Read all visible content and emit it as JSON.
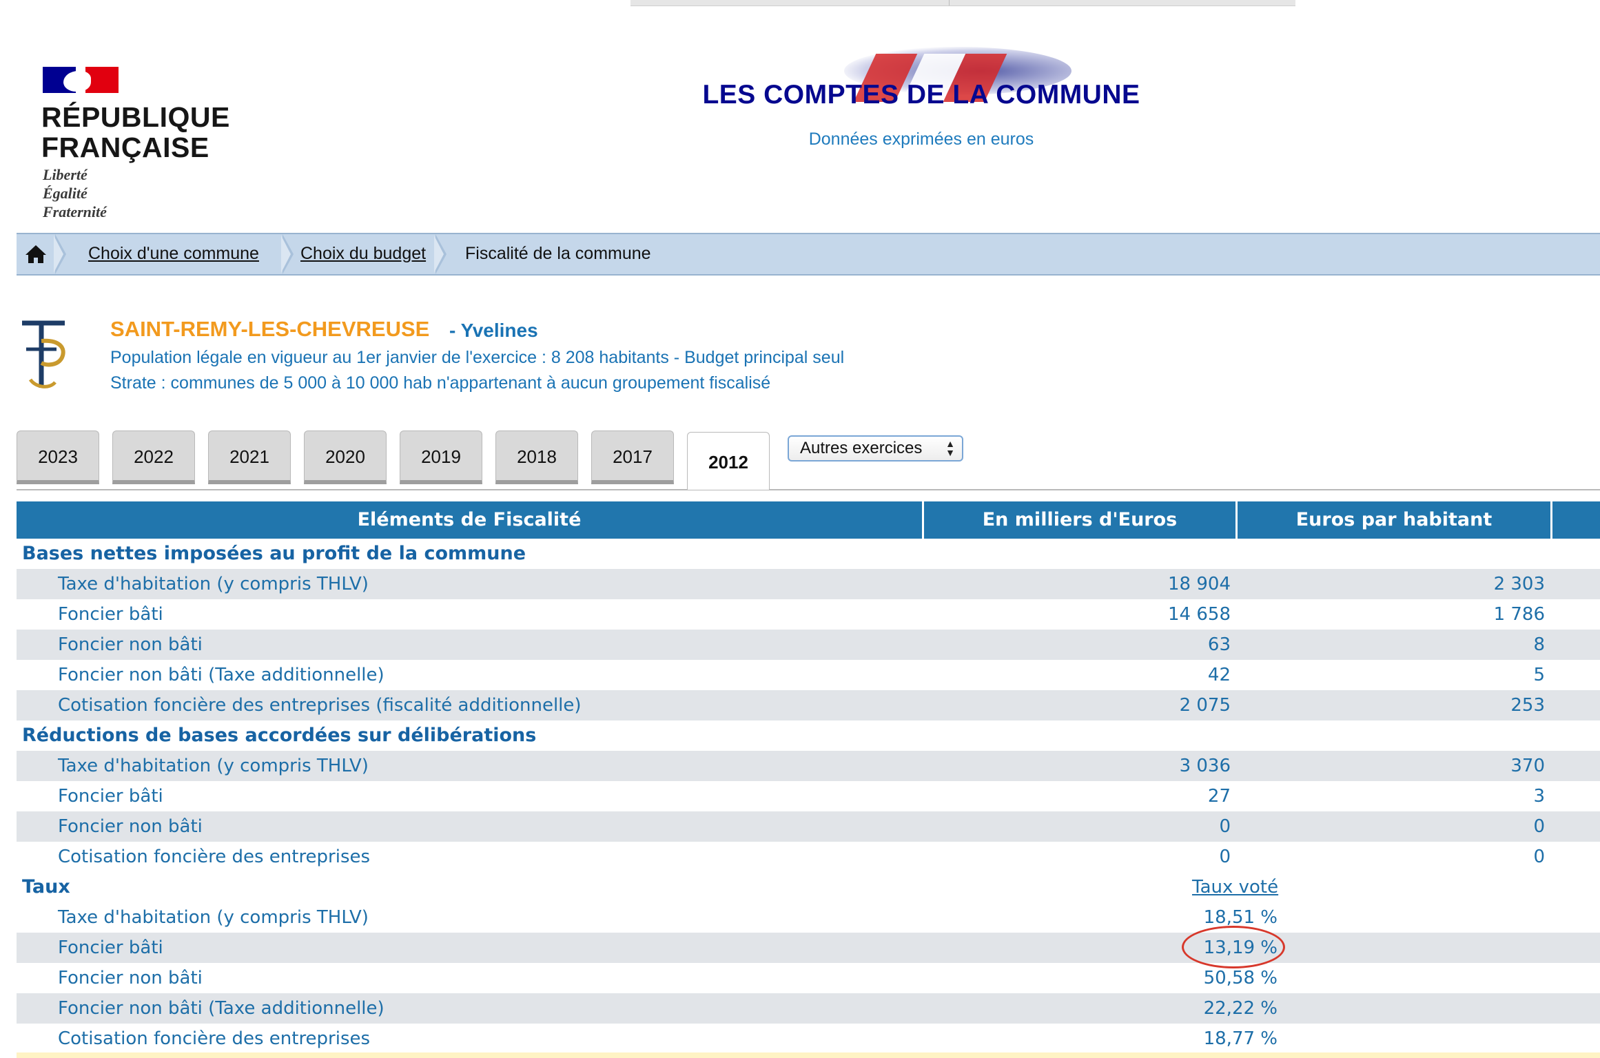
{
  "header": {
    "republic_name_line1": "RÉPUBLIQUE",
    "republic_name_line2": "FRANÇAISE",
    "motto": [
      "Liberté",
      "Égalité",
      "Fraternité"
    ],
    "title": "LES COMPTES DE LA COMMUNE",
    "subtitle": "Données exprimées en euros"
  },
  "breadcrumb": {
    "items": [
      "Choix d'une commune",
      "Choix du budget",
      "Fiscalité de la commune"
    ]
  },
  "commune": {
    "name": "SAINT-REMY-LES-CHEVREUSE",
    "dept": "- Yvelines",
    "population": "Population légale en vigueur au 1er janvier de l'exercice : 8 208 habitants - Budget principal seul",
    "strate": "Strate : communes de 5 000 à 10 000 hab n'appartenant à aucun groupement fiscalisé"
  },
  "tabs": [
    "2023",
    "2022",
    "2021",
    "2020",
    "2019",
    "2018",
    "2017",
    "2012"
  ],
  "active_tab": "2012",
  "select": {
    "value": "Autres exercices"
  },
  "table": {
    "headers": [
      "Eléments de Fiscalité",
      "En milliers d'Euros",
      "Euros par habitant"
    ],
    "sections": [
      {
        "title": "Bases nettes imposées au profit de la commune",
        "rows": [
          {
            "label": "Taxe d'habitation (y compris THLV)",
            "v1": "18 904",
            "v2": "2 303"
          },
          {
            "label": "Foncier bâti",
            "v1": "14 658",
            "v2": "1 786"
          },
          {
            "label": "Foncier non bâti",
            "v1": "63",
            "v2": "8"
          },
          {
            "label": "Foncier non bâti (Taxe additionnelle)",
            "v1": "42",
            "v2": "5"
          },
          {
            "label": "Cotisation foncière des entreprises (fiscalité additionnelle)",
            "v1": "2 075",
            "v2": "253"
          }
        ]
      },
      {
        "title": "Réductions de bases accordées sur délibérations",
        "rows": [
          {
            "label": "Taxe d'habitation (y compris THLV)",
            "v1": "3 036",
            "v2": "370"
          },
          {
            "label": "Foncier bâti",
            "v1": "27",
            "v2": "3"
          },
          {
            "label": "Foncier non bâti",
            "v1": "0",
            "v2": "0"
          },
          {
            "label": "Cotisation foncière des entreprises",
            "v1": "0",
            "v2": "0"
          }
        ]
      },
      {
        "title": "Taux",
        "subheader": "Taux voté",
        "rows": [
          {
            "label": "Taxe d'habitation (y compris THLV)",
            "rate": "18,51 %"
          },
          {
            "label": "Foncier bâti",
            "rate": "13,19 %"
          },
          {
            "label": "Foncier non bâti",
            "rate": "50,58 %"
          },
          {
            "label": "Foncier non bâti (Taxe additionnelle)",
            "rate": "22,22 %"
          },
          {
            "label": "Cotisation foncière des entreprises",
            "rate": "18,77 %"
          }
        ]
      }
    ]
  },
  "colors": {
    "header_blue": "#2176ad",
    "title_navy": "#06088f",
    "link_blue": "#1a73b4",
    "commune_orange": "#f29a1e",
    "annotation_red": "#d7382b"
  }
}
